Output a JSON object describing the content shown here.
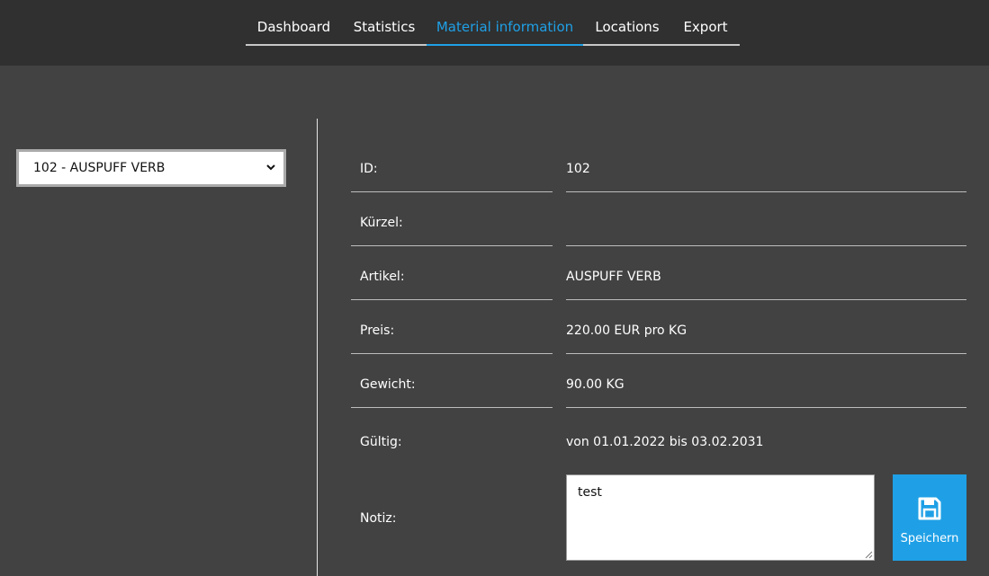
{
  "nav": {
    "items": [
      {
        "label": "Dashboard",
        "active": false
      },
      {
        "label": "Statistics",
        "active": false
      },
      {
        "label": "Material information",
        "active": true
      },
      {
        "label": "Locations",
        "active": false
      },
      {
        "label": "Export",
        "active": false
      }
    ]
  },
  "material_select": {
    "selected": "102 - AUSPUFF VERB"
  },
  "details": {
    "id_label": "ID:",
    "id_value": "102",
    "kuerzel_label": "Kürzel:",
    "kuerzel_value": "",
    "artikel_label": "Artikel:",
    "artikel_value": "AUSPUFF VERB",
    "preis_label": "Preis:",
    "preis_value": "220.00 EUR pro KG",
    "gewicht_label": "Gewicht:",
    "gewicht_value": "90.00 KG",
    "gueltig_label": "Gültig:",
    "gueltig_value": "von 01.01.2022 bis 03.02.2031",
    "notiz_label": "Notiz:",
    "notiz_value": "test"
  },
  "save_button": {
    "label": "Speichern",
    "icon": "floppy-disk-icon"
  },
  "colors": {
    "accent": "#1fa0e6",
    "topbar": "#303030",
    "background": "#424242"
  }
}
